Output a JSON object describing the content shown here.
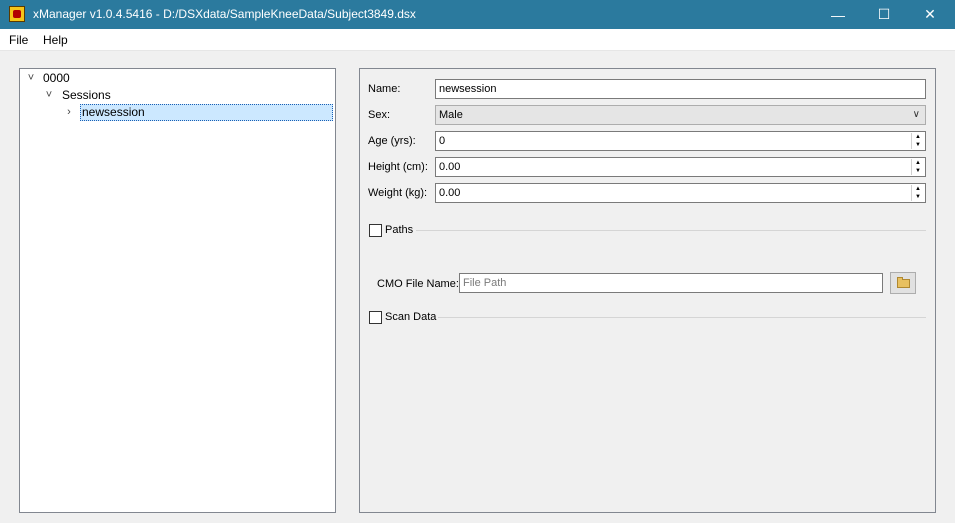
{
  "window": {
    "title": "xManager v1.0.4.5416  - D:/DSXdata/SampleKneeData/Subject3849.dsx",
    "minimize": "—",
    "maximize": "☐",
    "close": "✕"
  },
  "menu": {
    "file": "File",
    "help": "Help"
  },
  "tree": {
    "root": "0000",
    "sessions": "Sessions",
    "session": "newsession"
  },
  "form": {
    "name_label": "Name:",
    "name_value": "newsession",
    "sex_label": "Sex:",
    "sex_value": "Male",
    "age_label": "Age (yrs):",
    "age_value": "0",
    "height_label": "Height (cm):",
    "height_value": "0.00",
    "weight_label": "Weight (kg):",
    "weight_value": "0.00",
    "paths_label": "Paths",
    "cmo_label": "CMO File Name:",
    "cmo_placeholder": "File Path",
    "scan_label": "Scan Data"
  },
  "icons": {
    "app": "app-icon",
    "expand": "chevron-down-icon",
    "collapse": "chevron-right-icon",
    "folder": "folder-icon"
  },
  "colors": {
    "titlebar": "#2b7a9e",
    "selection": "#cce8ff"
  }
}
